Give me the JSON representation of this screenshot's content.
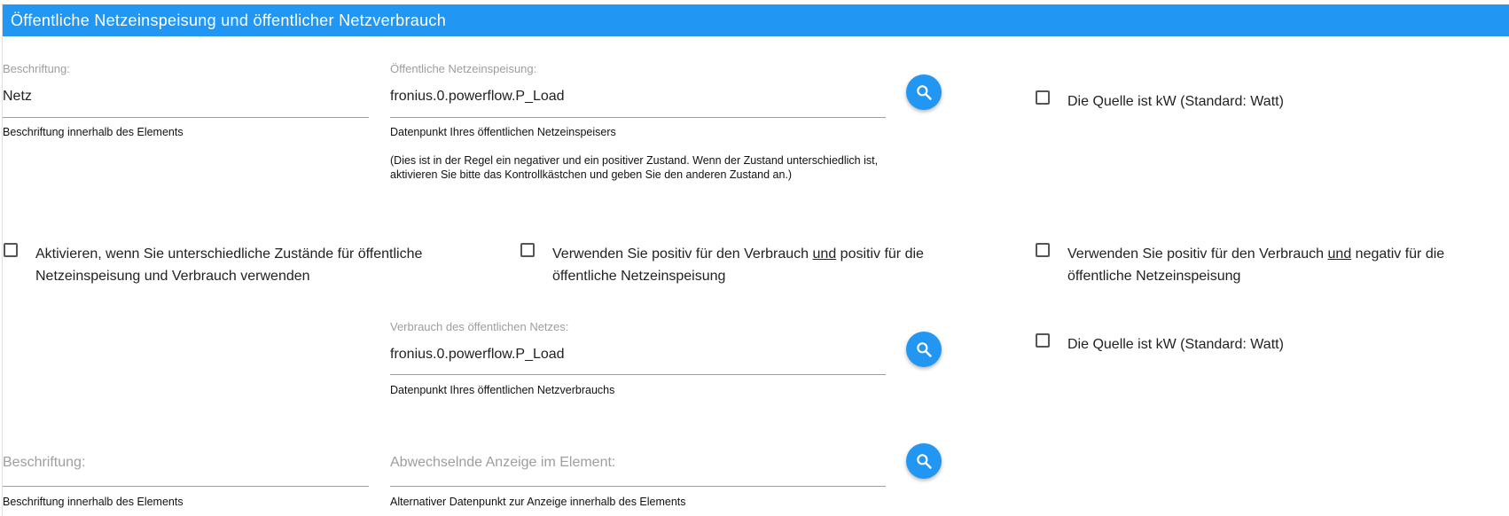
{
  "header": {
    "title": "Öffentliche Netzeinspeisung und öffentlicher Netzverbrauch"
  },
  "row1": {
    "caption": {
      "label": "Beschriftung:",
      "value": "Netz",
      "help": "Beschriftung innerhalb des Elements"
    },
    "feed_in": {
      "label": "Öffentliche Netzeinspeisung:",
      "value": "fronius.0.powerflow.P_Load",
      "help": "Datenpunkt Ihres öffentlichen Netzeinspeisers",
      "note": "(Dies ist in der Regel ein negativer und ein positiver Zustand. Wenn der Zustand unterschiedlich ist, aktivieren Sie bitte das Kontrollkästchen und geben Sie den anderen Zustand an.)"
    },
    "kw_checkbox": {
      "label": "Die Quelle ist kW (Standard: Watt)",
      "checked": false
    }
  },
  "row2": {
    "different_states": {
      "label": "Aktivieren, wenn Sie unterschiedliche Zustände für öffentliche Netzeinspeisung und Verbrauch verwenden",
      "checked": false
    },
    "positive_positive": {
      "label_a": "Verwenden Sie positiv für den Verbrauch ",
      "label_und": "und",
      "label_b": " positiv für die öffentliche Netzeinspeisung",
      "checked": false
    },
    "positive_negative": {
      "label_a": "Verwenden Sie positiv für den Verbrauch ",
      "label_und": "und",
      "label_b": " negativ für die öffentliche Netzeinspeisung",
      "checked": false
    }
  },
  "row3": {
    "consumption": {
      "label": "Verbrauch des öffentlichen Netzes:",
      "value": "fronius.0.powerflow.P_Load",
      "help": "Datenpunkt Ihres öffentlichen Netzverbrauchs"
    },
    "kw_checkbox": {
      "label": "Die Quelle ist kW (Standard: Watt)",
      "checked": false
    }
  },
  "row4": {
    "caption": {
      "placeholder": "Beschriftung:",
      "help": "Beschriftung innerhalb des Elements"
    },
    "alternate": {
      "placeholder": "Abwechselnde Anzeige im Element:",
      "help": "Alternativer Datenpunkt zur Anzeige innerhalb des Elements"
    }
  },
  "icons": {
    "search": "search-icon"
  },
  "colors": {
    "accent": "#2196f3"
  }
}
